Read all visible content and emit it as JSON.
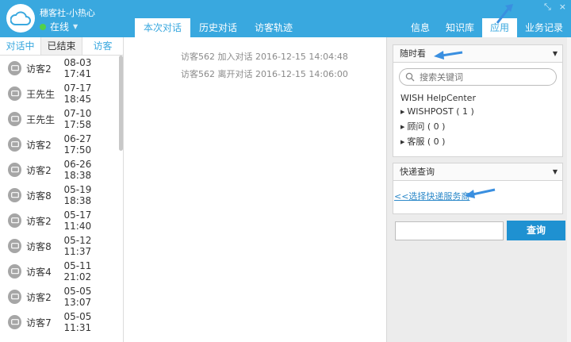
{
  "header": {
    "username": "穗客社-小热心",
    "status": "在线",
    "tabs": [
      {
        "label": "本次对话",
        "active": true
      },
      {
        "label": "历史对话",
        "active": false
      },
      {
        "label": "访客轨迹",
        "active": false
      }
    ],
    "right_tabs": [
      {
        "label": "信息",
        "active": false
      },
      {
        "label": "知识库",
        "active": false
      },
      {
        "label": "应用",
        "active": true
      },
      {
        "label": "业务记录",
        "active": false
      }
    ],
    "window_controls": [
      "⤡",
      "×"
    ]
  },
  "left": {
    "subtabs": [
      "对话中",
      "已结束",
      "访客"
    ],
    "visitors": [
      {
        "name": "访客2",
        "time": "08-03 17:41"
      },
      {
        "name": "王先生",
        "time": "07-17 18:45"
      },
      {
        "name": "王先生",
        "time": "07-10 17:58"
      },
      {
        "name": "访客2",
        "time": "06-27 17:50"
      },
      {
        "name": "访客2",
        "time": "06-26 18:38"
      },
      {
        "name": "访客8",
        "time": "05-19 18:38"
      },
      {
        "name": "访客2",
        "time": "05-17 11:40"
      },
      {
        "name": "访客8",
        "time": "05-12 11:37"
      },
      {
        "name": "访客4",
        "time": "05-11 21:02"
      },
      {
        "name": "访客2",
        "time": "05-05 13:07"
      },
      {
        "name": "访客7",
        "time": "05-05 11:31"
      }
    ]
  },
  "center": {
    "logs": [
      "访客562 加入对话 2016-12-15 14:04:48",
      "访客562 离开对话 2016-12-15 14:06:00"
    ]
  },
  "right": {
    "panel1": {
      "title": "随时看",
      "search_placeholder": "搜索关键词",
      "category": "WISH HelpCenter",
      "items": [
        "WISHPOST ( 1 )",
        "顾问 ( 0 )",
        "客服 ( 0 )"
      ]
    },
    "panel2": {
      "title": "快递查询",
      "link": "<<选择快递服务商"
    },
    "query_button": "查询"
  },
  "colors": {
    "header": "#39a8df",
    "accent": "#1f91d1",
    "arrow": "#3a8fe0"
  }
}
